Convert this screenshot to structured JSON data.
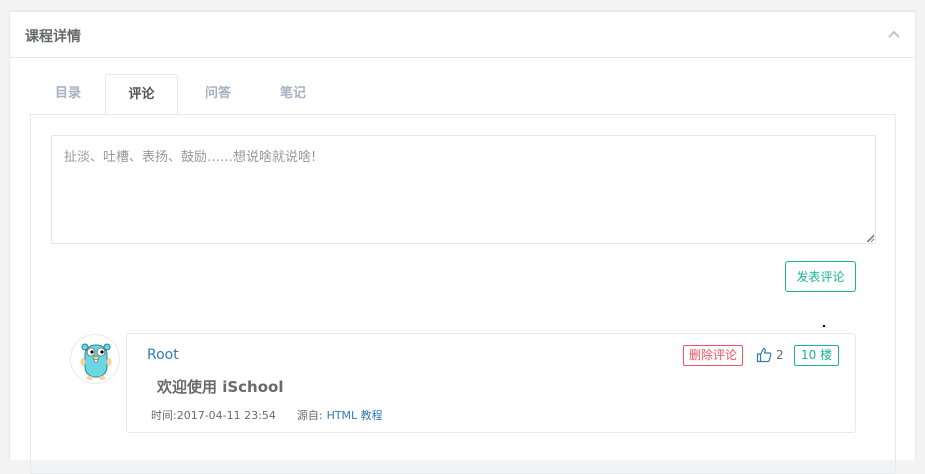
{
  "panel": {
    "title": "课程详情",
    "collapse_icon": "chevron-up-icon"
  },
  "tabs": [
    {
      "label": "目录",
      "active": false
    },
    {
      "label": "评论",
      "active": true
    },
    {
      "label": "问答",
      "active": false
    },
    {
      "label": "笔记",
      "active": false
    }
  ],
  "comment_form": {
    "placeholder": "扯淡、吐槽、表扬、鼓励……想说啥就说啥!",
    "value": "",
    "submit_label": "发表评论"
  },
  "comments": [
    {
      "username": "Root",
      "avatar_icon": "gopher-avatar-icon",
      "delete_label": "删除评论",
      "like_icon": "thumbs-up-icon",
      "likes": "2",
      "floor": "10 楼",
      "text": "欢迎使用 iSchool",
      "time_label": "时间:",
      "time": "2017-04-11 23:54",
      "source_label": "源自:",
      "source": "HTML 教程"
    }
  ],
  "colors": {
    "accent": "#1ab394",
    "danger": "#ed5565",
    "link": "#337ab7",
    "text": "#676a6c",
    "muted_tab": "#a7b1c2"
  }
}
